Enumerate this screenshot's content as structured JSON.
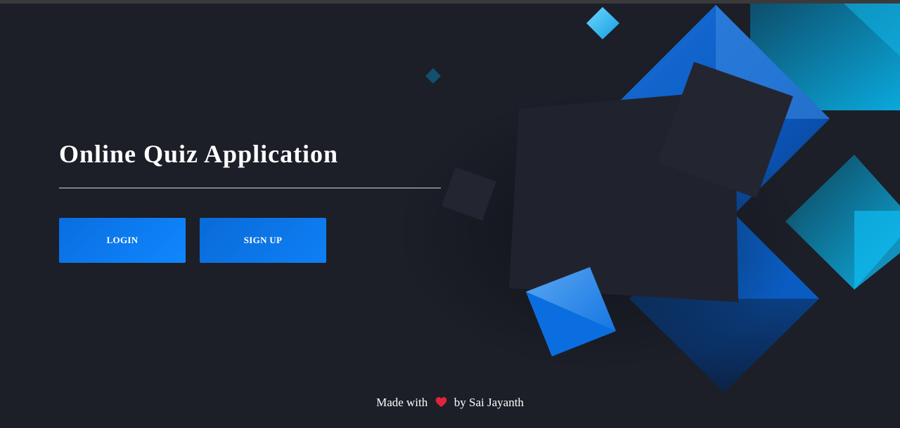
{
  "app": {
    "title": "Online Quiz Application"
  },
  "actions": {
    "login_label": "LOGIN",
    "signup_label": "SIGN UP"
  },
  "footer": {
    "prefix": "Made with",
    "icon": "heart-icon",
    "suffix": "by Sai Jayanth"
  },
  "colors": {
    "background": "#1c1f28",
    "button": "#0f87ff",
    "accent_blue": "#0a6ee0",
    "accent_cyan": "#17b8f0",
    "heart": "#e0243a"
  }
}
